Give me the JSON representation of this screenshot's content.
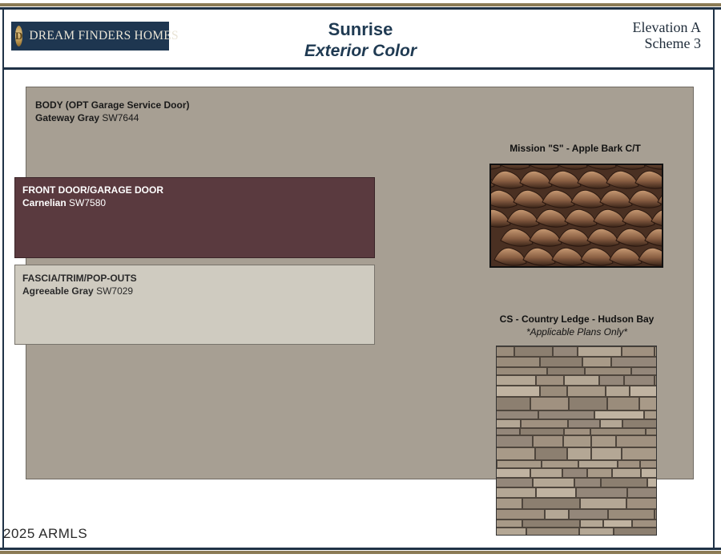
{
  "brand": {
    "logo_text": "DREAM FINDERS HOMES",
    "seal_letter": "D"
  },
  "header": {
    "title": "Sunrise",
    "subtitle": "Exterior Color",
    "elevation": "Elevation A",
    "scheme": "Scheme 3"
  },
  "swatches": [
    {
      "area": "BODY (OPT Garage Service Door)",
      "color_name": "Gateway Gray",
      "code": "SW7644",
      "hex": "#a79f93"
    },
    {
      "area": "FRONT DOOR/GARAGE DOOR",
      "color_name": "Carnelian",
      "code": "SW7580",
      "hex": "#5a3a3f"
    },
    {
      "area": "FASCIA/TRIM/POP-OUTS",
      "color_name": "Agreeable Gray",
      "code": "SW7029",
      "hex": "#cfcbc0"
    }
  ],
  "roof": {
    "caption": "Mission \"S\" - Apple Bark C/T"
  },
  "stone": {
    "caption": "CS - Country Ledge - Hudson Bay",
    "note": "*Applicable Plans Only*"
  },
  "footer": {
    "watermark": "2025 ARMLS"
  },
  "colors": {
    "navy": "#1f3246",
    "gold": "#8b7b55",
    "logo_bg": "#1e3650"
  }
}
